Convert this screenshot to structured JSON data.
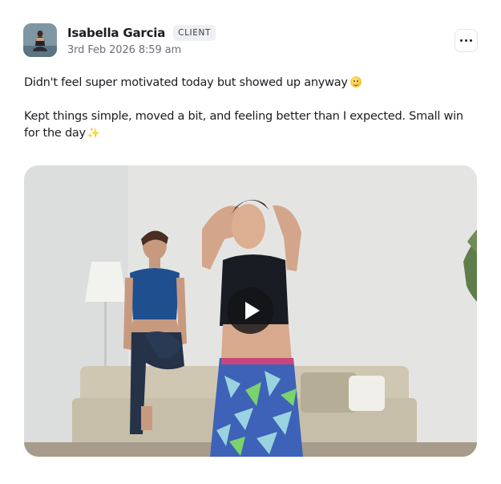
{
  "post": {
    "author": {
      "name": "Isabella Garcia",
      "role_badge": "CLIENT",
      "avatar_icon": "user-avatar-photo"
    },
    "timestamp": "3rd Feb 2026 8:59 am",
    "more_icon": "more-horizontal-icon",
    "text": {
      "line1": "Didn't feel super motivated today but showed up anyway",
      "line1_emoji": "slightly-smiling-face",
      "line2": "Kept things simple, moved a bit, and feeling better than I expected. Small win for the day",
      "line2_emoji": "sparkles"
    },
    "video": {
      "play_icon": "play-icon"
    }
  },
  "colors": {
    "badge_bg": "#eef0f3",
    "text": "#1c1c22",
    "muted": "#6d6f78",
    "play_bg": "#141416"
  }
}
